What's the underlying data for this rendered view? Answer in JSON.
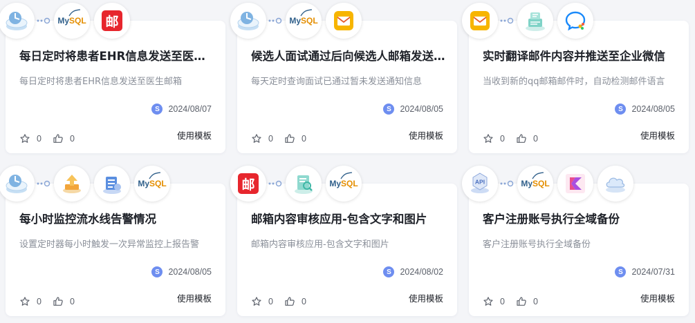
{
  "cards": [
    {
      "title": "每日定时将患者EHR信息发送至医生邮箱",
      "desc": "每日定时将患者EHR信息发送至医生邮箱",
      "avatar": "S",
      "date": "2024/08/07",
      "stars": "0",
      "likes": "0",
      "action": "使用模板",
      "icons": [
        "timer-icon",
        "mysql-logo",
        "chinese-mail-icon"
      ]
    },
    {
      "title": "候选人面试通过后向候选人邮箱发送通知",
      "desc": "每天定时查询面试已通过暂未发送通知信息",
      "avatar": "S",
      "date": "2024/08/05",
      "stars": "0",
      "likes": "0",
      "action": "使用模板",
      "icons": [
        "timer-icon",
        "mysql-logo",
        "email-icon"
      ]
    },
    {
      "title": "实时翻译邮件内容并推送至企业微信",
      "desc": "当收到新的qq邮箱邮件时，自动检测邮件语言",
      "avatar": "S",
      "date": "2024/08/05",
      "stars": "0",
      "likes": "0",
      "action": "使用模板",
      "icons": [
        "email-icon",
        "translate-icon",
        "wecom-icon"
      ]
    },
    {
      "title": "每小时监控流水线告警情况",
      "desc": "设置定时器每小时触发一次异常监控上报告警",
      "avatar": "S",
      "date": "2024/08/05",
      "stars": "0",
      "likes": "0",
      "action": "使用模板",
      "icons": [
        "timer-icon",
        "pipeline-icon",
        "monitor-icon",
        "mysql-logo"
      ]
    },
    {
      "title": "邮箱内容审核应用-包含文字和图片",
      "desc": "邮箱内容审核应用-包含文字和图片",
      "avatar": "S",
      "date": "2024/08/02",
      "stars": "0",
      "likes": "0",
      "action": "使用模板",
      "icons": [
        "chinese-mail-icon",
        "content-audit-icon",
        "mysql-logo"
      ]
    },
    {
      "title": "客户注册账号执行全域备份",
      "desc": "客户注册账号执行全域备份",
      "avatar": "S",
      "date": "2024/07/31",
      "stars": "0",
      "likes": "0",
      "action": "使用模板",
      "icons": [
        "api-icon",
        "mysql-logo",
        "kotlin-icon",
        "cloud-storage-icon"
      ]
    }
  ],
  "logos": {
    "mysql_text": "My",
    "mysql_q": "SQL",
    "mail_glyph": "邮",
    "api_text": "API"
  },
  "colors": {
    "accent": "#6e8ef0",
    "mail_red": "#e7262d",
    "mail_yellow": "#f7b500",
    "kotlin_pink": "#e94c8d"
  }
}
